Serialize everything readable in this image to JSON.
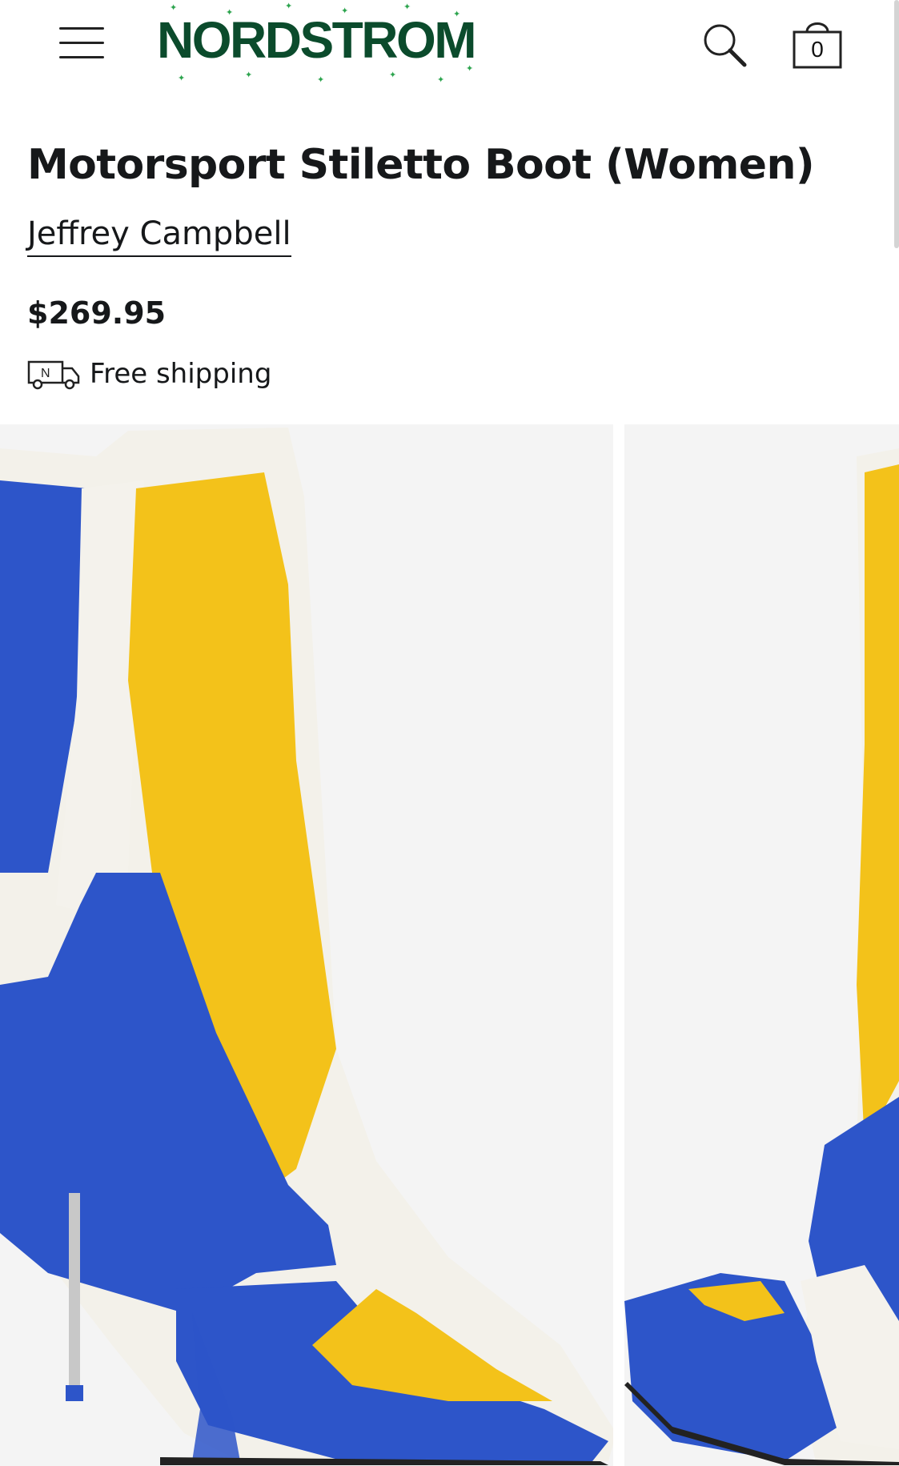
{
  "header": {
    "logo_text": "NORDSTROM",
    "cart_count": "0",
    "menu_icon": "hamburger-menu-icon",
    "search_icon": "search-icon",
    "cart_icon": "shopping-bag-icon"
  },
  "product": {
    "title": "Motorsport Stiletto Boot (Women)",
    "brand": "Jeffrey Campbell",
    "price": "$269.95",
    "shipping_label": "Free shipping",
    "shipping_icon": "delivery-truck-icon",
    "shipping_icon_letter": "N"
  },
  "colors": {
    "logo_green": "#0b4b2c",
    "sparkle_green": "#2da44e",
    "boot_blue": "#2d55c9",
    "boot_yellow": "#f3c21a",
    "boot_white": "#f4f2ec",
    "photo_background": "#f4f4f4"
  }
}
